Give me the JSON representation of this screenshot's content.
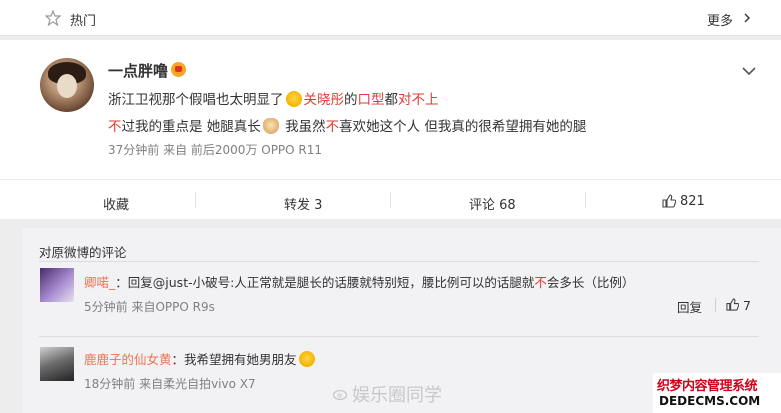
{
  "header": {
    "hot_label": "热门",
    "more_label": "更多"
  },
  "post": {
    "username": "一点胖噜",
    "line1": {
      "a": "浙江卫视那个假唱也太明显了",
      "b": "关晓彤",
      "c": "的",
      "d": "口型",
      "e": "都",
      "f": "对不上"
    },
    "line2": {
      "a": "不",
      "b": "过我的重点是 她腿真长",
      "c": " 我虽然",
      "d": "不",
      "e": "喜欢她这个人 但我真的很希望拥有她的腿"
    },
    "meta": "37分钟前 来自 前后2000万 OPPO R11",
    "actions": {
      "collect": "收藏",
      "repost": "转发 3",
      "comment": "评论 68",
      "likes": "821"
    }
  },
  "comments": {
    "title": "对原微博的评论",
    "items": [
      {
        "name": "卿喏_",
        "sep": "：",
        "text_a": "回复@just-小破号:人正常就是腿长的话腰就特别短，腰比例可以的话腿就",
        "text_red": "不",
        "text_b": "会多长（比例）",
        "meta": "5分钟前 来自OPPO R9s",
        "reply": "回复",
        "likes": "7"
      },
      {
        "name": "鹿鹿子的仙女黄",
        "sep": "：",
        "text_a": "我希望拥有她男朋友",
        "meta": "18分钟前 来自柔光自拍vivo X7"
      }
    ]
  },
  "watermark": "娱乐圈同学",
  "corner": {
    "line1": "织梦内容管理系统",
    "line2": "DEDECMS.COM"
  },
  "colors": {
    "accent_red": "#e53935",
    "name_orange": "#eb7350"
  }
}
